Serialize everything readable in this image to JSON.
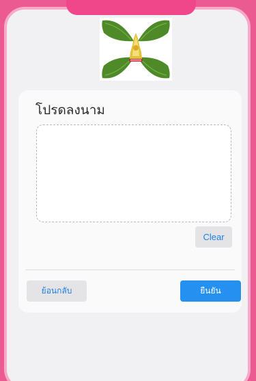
{
  "colors": {
    "frame": "#ec5a92",
    "screen_border": "#f7a9c8",
    "accent_blue": "#2590f0",
    "link_blue": "#1d7fe0",
    "leaf_green": "#4f8a28"
  },
  "logo": {
    "icon": "university-emblem-icon"
  },
  "signature": {
    "title": "โปรดลงนาม",
    "clear_label": "Clear"
  },
  "actions": {
    "back_label": "ย้อนกลับ",
    "confirm_label": "ยืนยัน"
  }
}
